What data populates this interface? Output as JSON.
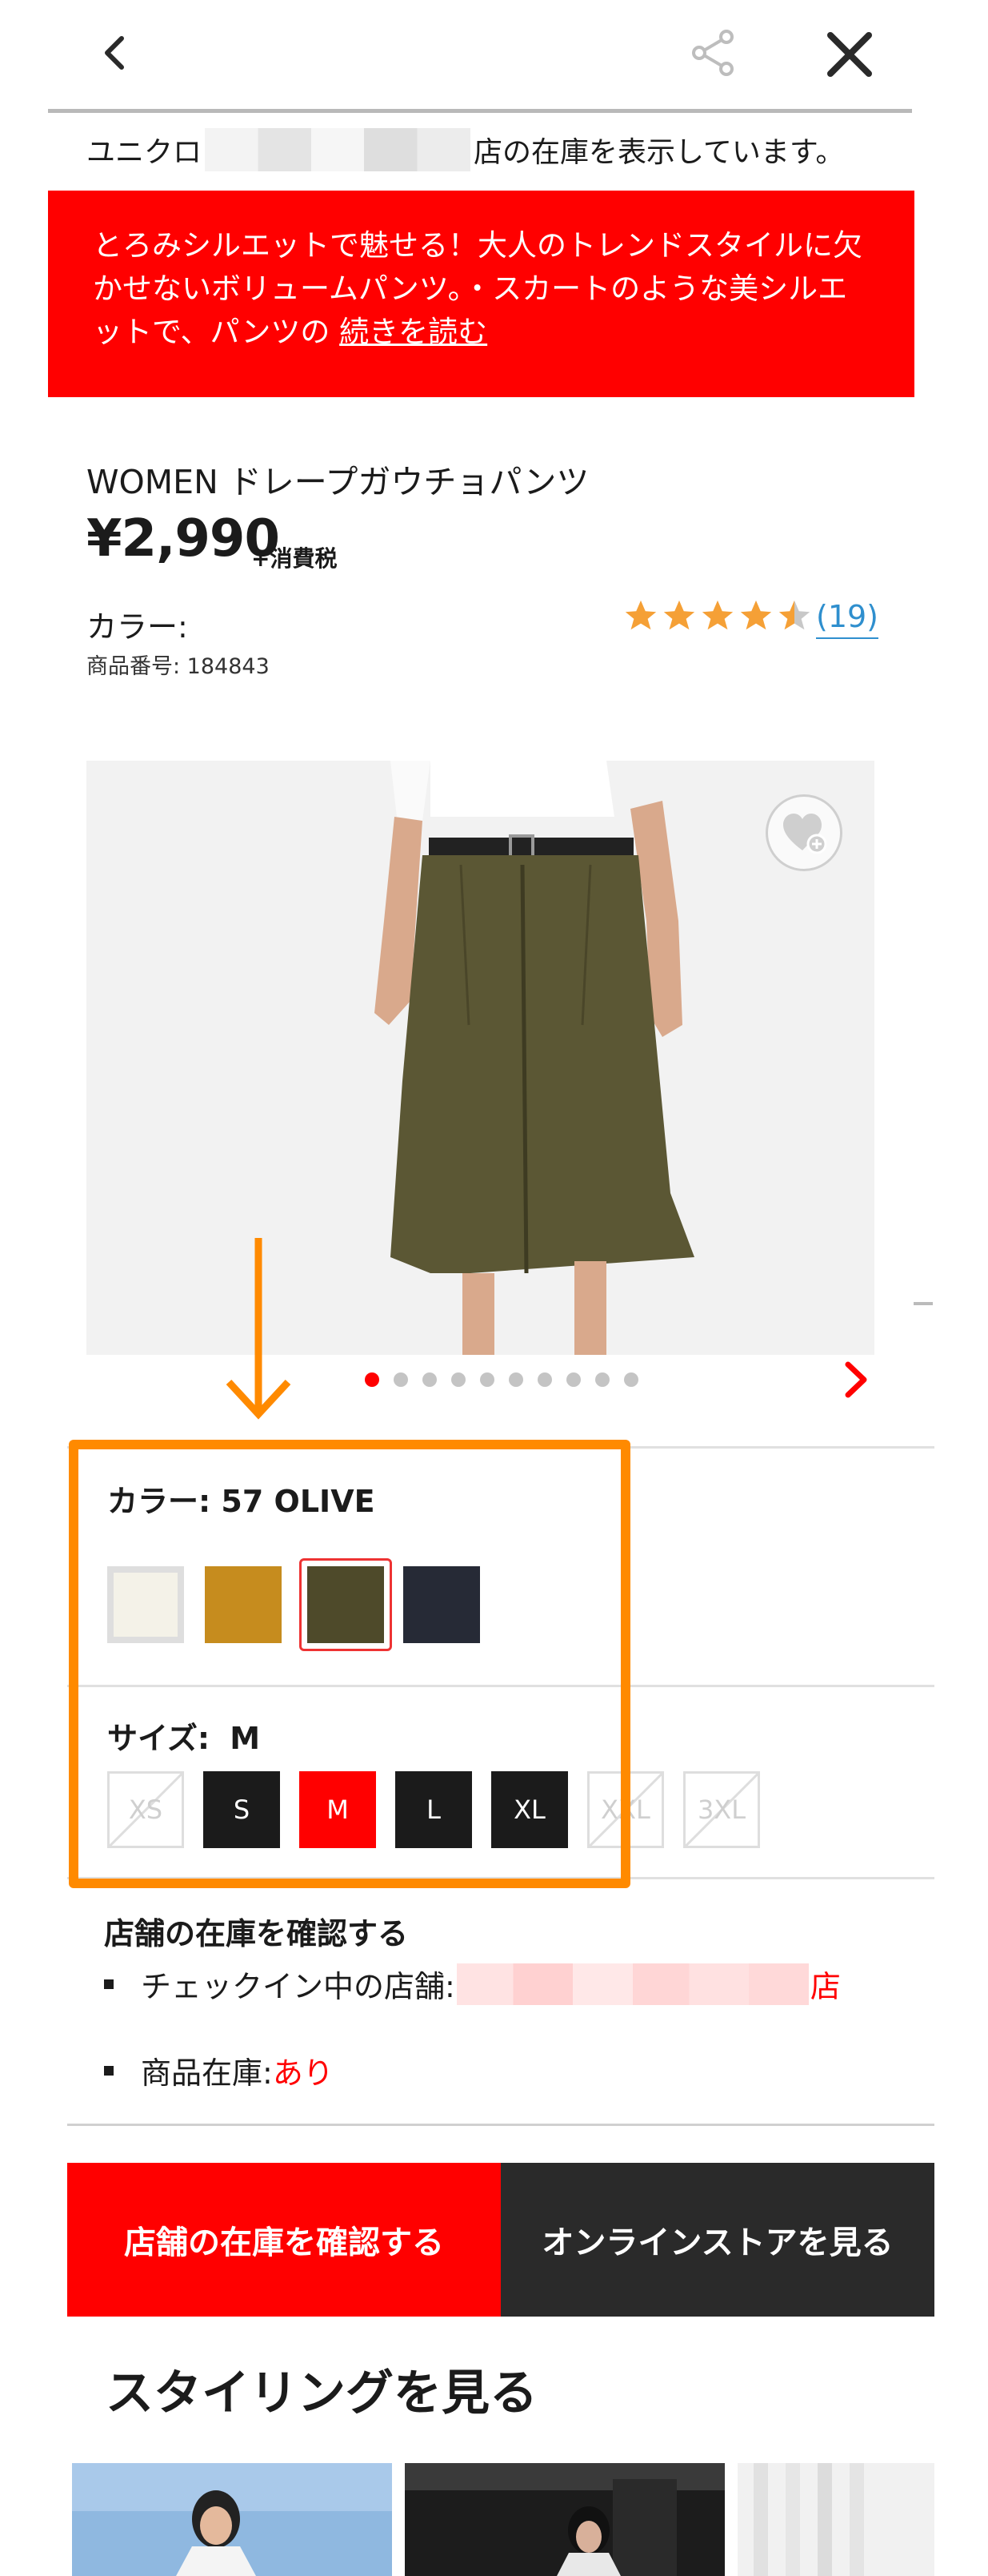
{
  "header": {
    "back_icon": "chevron-left-icon",
    "share_icon": "share-icon",
    "close_icon": "close-icon"
  },
  "store_notice": {
    "prefix": "ユニクロ",
    "suffix": "店の在庫を表示しています。"
  },
  "promo": {
    "text": "とろみシルエットで魅せる！大人のトレンドスタイルに欠かせないボリュームパンツ。・スカートのような美シルエットで、パンツの ",
    "more_link": "続きを読む"
  },
  "product": {
    "name": "WOMEN ドレープガウチョパンツ",
    "price": "¥2,990",
    "tax_note": "+消費税",
    "color_label": "カラー:",
    "sku": "商品番号: 184843",
    "rating": 4.5,
    "review_count": "(19)"
  },
  "gallery": {
    "image_count": 10,
    "active_index": 0,
    "favorite_icon": "heart-plus-icon",
    "next_icon": "chevron-right-icon"
  },
  "selector": {
    "color_label": "カラー: 57 OLIVE",
    "colors": [
      {
        "name": "off-white",
        "hex": "#f4f2e8"
      },
      {
        "name": "mustard",
        "hex": "#c68c1e"
      },
      {
        "name": "olive",
        "hex": "#4e4a2a",
        "selected": true
      },
      {
        "name": "navy",
        "hex": "#262a36"
      }
    ],
    "size_label": "サイズ:",
    "size_value": "M",
    "sizes": [
      {
        "label": "XS",
        "state": "unavailable"
      },
      {
        "label": "S",
        "state": "available"
      },
      {
        "label": "M",
        "state": "selected"
      },
      {
        "label": "L",
        "state": "available"
      },
      {
        "label": "XL",
        "state": "available"
      },
      {
        "label": "XXL",
        "state": "unavailable"
      },
      {
        "label": "3XL",
        "state": "unavailable"
      }
    ]
  },
  "stock": {
    "title": "店舗の在庫を確認する",
    "checkin_label": "チェックイン中の店舗:",
    "checkin_suffix": "店",
    "inventory_label": "商品在庫: ",
    "inventory_value": "あり"
  },
  "actions": {
    "check_store": "店舗の在庫を確認する",
    "online_store": "オンラインストアを見る"
  },
  "styling": {
    "title": "スタイリングを見る"
  },
  "colors": {
    "brand_red": "#ff0000",
    "highlight_orange": "#ff8a00",
    "link_blue": "#2f8fce",
    "star_orange": "#f5a036"
  }
}
